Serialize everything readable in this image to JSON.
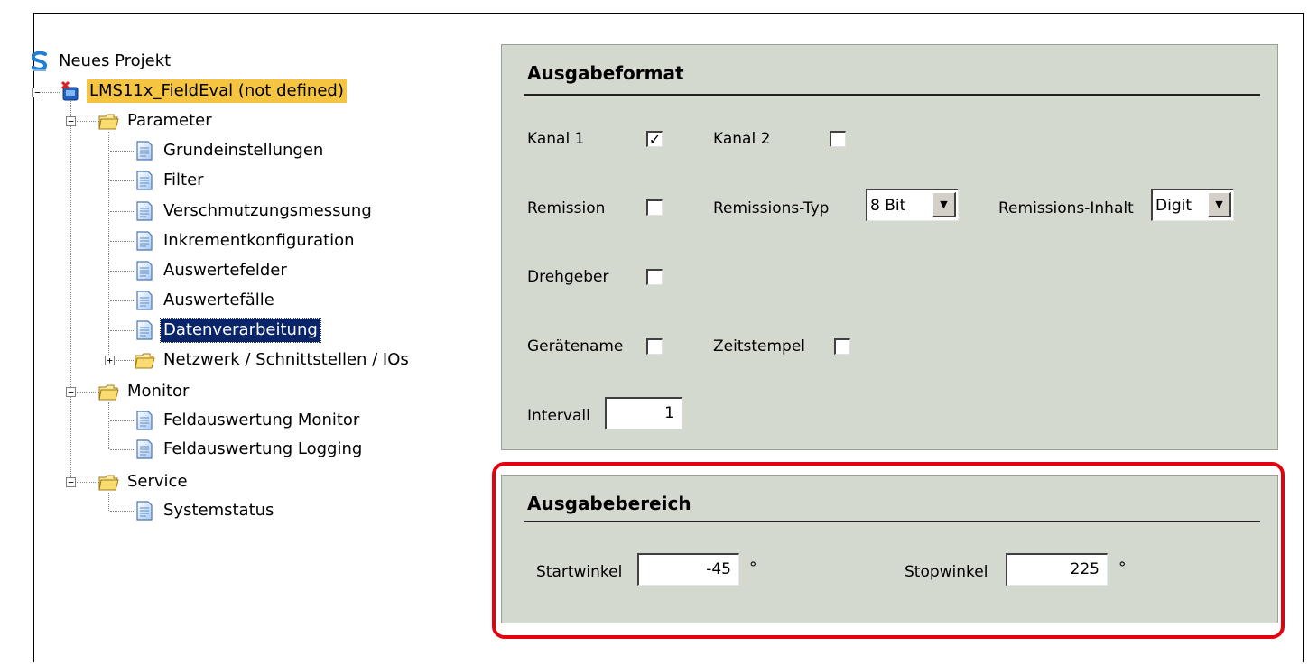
{
  "tree": {
    "project": "Neues Projekt",
    "device": "LMS11x_FieldEval (not defined)",
    "parameter": {
      "label": "Parameter",
      "items": [
        "Grundeinstellungen",
        "Filter",
        "Verschmutzungsmessung",
        "Inkrementkonfiguration",
        "Auswertefelder",
        "Auswertefälle",
        "Datenverarbeitung"
      ],
      "network": "Netzwerk / Schnittstellen / IOs"
    },
    "monitor": {
      "label": "Monitor",
      "items": [
        "Feldauswertung Monitor",
        "Feldauswertung Logging"
      ]
    },
    "service": {
      "label": "Service",
      "items": [
        "Systemstatus"
      ]
    },
    "selected": "Datenverarbeitung",
    "colors": {
      "device_highlight": "#f5c542",
      "selection": "#0a246a"
    }
  },
  "ausgabeformat": {
    "title": "Ausgabeformat",
    "kanal1": {
      "label": "Kanal 1",
      "checked": true,
      "mark": "✓"
    },
    "kanal2": {
      "label": "Kanal 2",
      "checked": false
    },
    "remission": {
      "label": "Remission",
      "checked": false
    },
    "remissions_typ": {
      "label": "Remissions-Typ",
      "value": "8 Bit"
    },
    "remissions_inhalt": {
      "label": "Remissions-Inhalt",
      "value": "Digit"
    },
    "drehgeber": {
      "label": "Drehgeber",
      "checked": false
    },
    "geraetename": {
      "label": "Gerätename",
      "checked": false
    },
    "zeitstempel": {
      "label": "Zeitstempel",
      "checked": false
    },
    "intervall": {
      "label": "Intervall",
      "value": "1"
    }
  },
  "ausgabebereich": {
    "title": "Ausgabebereich",
    "startwinkel": {
      "label": "Startwinkel",
      "value": "-45",
      "unit": "°"
    },
    "stopwinkel": {
      "label": "Stopwinkel",
      "value": "225",
      "unit": "°"
    },
    "highlight_color": "#e3000f"
  },
  "icons": {
    "project": "sopas-project-icon",
    "device": "device-icon",
    "folder": "folder-icon",
    "page": "page-icon",
    "dropdown": "dropdown-arrow-icon"
  }
}
